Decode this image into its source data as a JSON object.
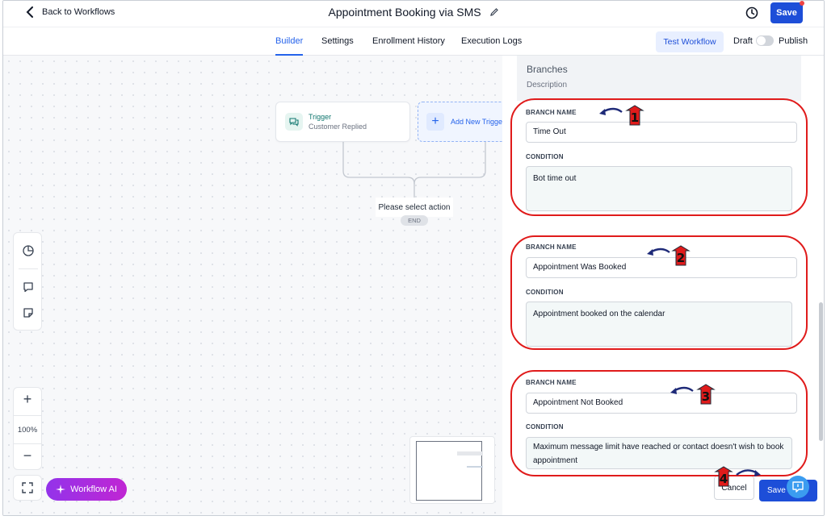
{
  "header": {
    "back_label": "Back to Workflows",
    "title": "Appointment Booking via SMS",
    "save_label": "Save"
  },
  "tabs": [
    {
      "label": "Builder",
      "active": true
    },
    {
      "label": "Settings",
      "active": false
    },
    {
      "label": "Enrollment History",
      "active": false
    },
    {
      "label": "Execution Logs",
      "active": false
    }
  ],
  "toolbar": {
    "test_workflow_label": "Test Workflow",
    "draft_label": "Draft",
    "publish_label": "Publish",
    "publish_toggle_on": false
  },
  "canvas": {
    "trigger_title": "Trigger",
    "trigger_subtitle": "Customer Replied",
    "add_trigger_label": "Add New Trigger",
    "select_action_label": "Please select action",
    "end_label": "END",
    "zoom_level": "100%",
    "workflow_ai_label": "Workflow AI"
  },
  "panel": {
    "heading": "Branches",
    "description_label": "Description",
    "branch_name_label": "BRANCH NAME",
    "condition_label": "CONDITION",
    "branches": [
      {
        "name": "Time Out",
        "condition": "Bot time out",
        "marker": "1"
      },
      {
        "name": "Appointment Was Booked",
        "condition": "Appointment booked on the calendar",
        "marker": "2"
      },
      {
        "name": "Appointment Not Booked",
        "condition": "Maximum message limit have reached or contact doesn't wish to book appointment",
        "marker": "3"
      }
    ],
    "cancel_label": "Cancel",
    "save_label": "Save",
    "footer_marker": "4"
  },
  "colors": {
    "accent": "#2563eb",
    "primary_button": "#1d4ed8",
    "annotation_red": "#e01b1b",
    "annotation_arrow": "#1e2a78",
    "workflow_ai_gradient_start": "#9333ea",
    "workflow_ai_gradient_end": "#c026d3"
  }
}
